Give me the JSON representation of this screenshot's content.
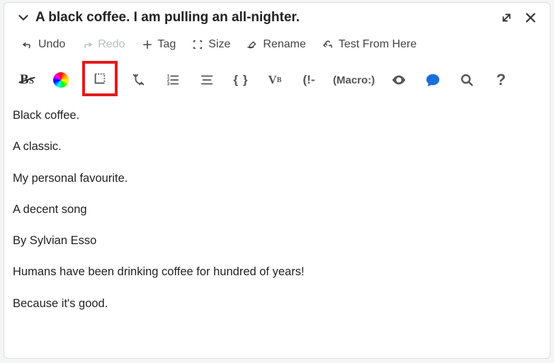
{
  "header": {
    "title": "A black coffee. I am pulling an all-nighter."
  },
  "toolbar1": {
    "undo": "Undo",
    "redo": "Redo",
    "tag": "Tag",
    "size": "Size",
    "rename": "Rename",
    "test": "Test From Here"
  },
  "toolbar2": {
    "braces": "{ }",
    "vb": "Vb",
    "exclaim": "(!-",
    "macro": "(Macro:)",
    "help": "?"
  },
  "content": {
    "p1": "Black coffee.",
    "p2": "A classic.",
    "p3": "My personal favourite.",
    "p4": "A decent song",
    "p5": "By Sylvian Esso",
    "p6": "Humans have been drinking coffee for hundred of years!",
    "p7": "Because it's good."
  }
}
